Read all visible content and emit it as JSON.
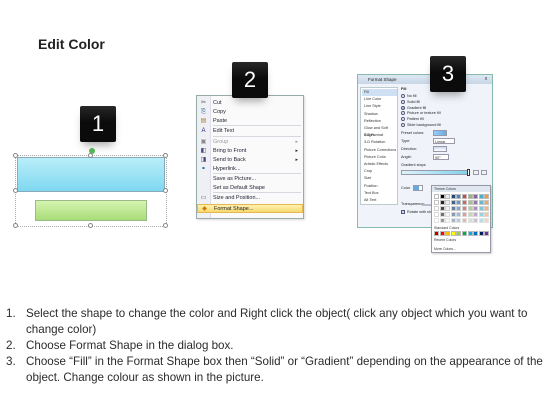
{
  "title": "Edit Color",
  "badges": [
    "1",
    "2",
    "3"
  ],
  "context_menu": {
    "items": [
      {
        "label": "Cut",
        "icon": "scissors-icon",
        "glyph": "✂"
      },
      {
        "label": "Copy",
        "icon": "copy-icon",
        "glyph": "⎘"
      },
      {
        "label": "Paste",
        "icon": "paste-icon",
        "glyph": "▤"
      },
      {
        "label": "Edit Text",
        "icon": "edit-text-icon",
        "glyph": "A"
      },
      {
        "label": "Group",
        "icon": "group-icon",
        "glyph": "▣",
        "disabled": true,
        "submenu": true
      },
      {
        "label": "Bring to Front",
        "icon": "bring-front-icon",
        "glyph": "◧",
        "submenu": true
      },
      {
        "label": "Send to Back",
        "icon": "send-back-icon",
        "glyph": "◨",
        "submenu": true
      },
      {
        "label": "Hyperlink...",
        "icon": "hyperlink-icon",
        "glyph": "⚭"
      },
      {
        "label": "Save as Picture...",
        "icon": "",
        "glyph": ""
      },
      {
        "label": "Set as Default Shape",
        "icon": "",
        "glyph": ""
      },
      {
        "label": "Size and Position...",
        "icon": "size-icon",
        "glyph": "▭"
      },
      {
        "label": "Format Shape...",
        "icon": "format-shape-icon",
        "glyph": "◆",
        "highlighted": true
      }
    ]
  },
  "dialog": {
    "title": "Format Shape",
    "close": "x",
    "categories": [
      "Fill",
      "Line Color",
      "Line Style",
      "Shadow",
      "Reflection",
      "Glow and Soft Edges",
      "3-D Format",
      "3-D Rotation",
      "Picture Corrections",
      "Picture Color",
      "Artistic Effects",
      "Crop",
      "Size",
      "Position",
      "Text Box",
      "Alt Text"
    ],
    "section": "Fill",
    "fill_options": [
      "No fill",
      "Solid fill",
      "Gradient fill",
      "Picture or texture fill",
      "Pattern fill",
      "Slide background fill"
    ],
    "selected_fill": "Gradient fill",
    "fields": {
      "preset_colors": "Preset colors:",
      "type": "Type:",
      "type_value": "Linear",
      "direction": "Direction:",
      "angle": "Angle:",
      "angle_value": "90°",
      "gradient_stops": "Gradient stops",
      "color": "Color",
      "position": "Position:",
      "position_value": "100%",
      "brightness": "Brightness:",
      "transparency": "Transparency:",
      "rotate_with_shape": "Rotate with shape"
    },
    "close_button": "Close"
  },
  "palette": {
    "title": "Theme Colors",
    "standard": "Standard Colors",
    "recent": "Recent Colors",
    "more": "More Colors...",
    "theme_colors": [
      "#ffffff",
      "#000000",
      "#eeece1",
      "#1f497d",
      "#4f81bd",
      "#c0504d",
      "#9bbb59",
      "#8064a2",
      "#4bacc6",
      "#f79646"
    ],
    "standard_colors": [
      "#c00000",
      "#ff0000",
      "#ffc000",
      "#ffff00",
      "#92d050",
      "#00b050",
      "#00b0f0",
      "#0070c0",
      "#002060",
      "#7030a0"
    ]
  },
  "steps": [
    {
      "num": "1.",
      "text": "Select the shape to change the color and Right click the object( click any object which you want to change color)"
    },
    {
      "num": "2.",
      "text": "Choose Format Shape in the dialog box."
    },
    {
      "num": "3.",
      "text": "Choose “Fill” in the Format Shape box then “Solid” or “Gradient” depending on the appearance of the object. Change colour as shown in the picture."
    }
  ]
}
